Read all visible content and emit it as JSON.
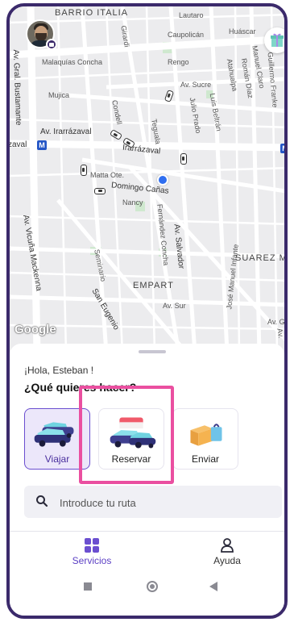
{
  "map": {
    "labels": {
      "barrio": "BARRIO ITALIA",
      "lautaro": "Lautaro",
      "caupolican": "Caupolicán",
      "huascar": "Huáscar",
      "grl_bustamante": "Av. Gral. Bustamante",
      "malaquias": "Malaquías Concha",
      "girardi": "Girardi",
      "rengo": "Rengo",
      "manuel_claro": "Manuel Claro",
      "roman_diaz": "Román Díaz",
      "atahualpa": "Atahualpa",
      "guillermo_franke": "Guillermo Franke",
      "mujica": "Mujica",
      "av_sucre": "Av. Sucre",
      "luis_beltran": "Luis Beltrán",
      "julio_prado": "Julio Prado",
      "condell": "Condell",
      "irarrazaval": "Av. Irarrázaval",
      "zaval": "zaval",
      "irarrazaval_mid": "Irarrázaval",
      "teguala": "Teguala",
      "matta_ote": "Matta Ote.",
      "domingo_canas": "Domingo Cañas",
      "nancy": "Nancy",
      "fernandez_concha": "Fernández Concha",
      "av_salvador": "Av. Salvador",
      "jose_manuel_infante": "José Manuel Infante",
      "suarez": "SUAREZ MUJ",
      "vicuna": "Av. Vicuña Mackenna",
      "seminario": "Seminario",
      "empart": "EMPART",
      "av_sur": "Av. Sur",
      "san_eugenio": "San Eugenio",
      "av_gre": "Av. Gre",
      "av": "Av.",
      "metro": "M",
      "google": "Google"
    }
  },
  "sheet": {
    "greeting": "¡Hola, Esteban !",
    "question": "¿Qué quieres hacer?",
    "options": [
      {
        "label": "Viajar",
        "active": true
      },
      {
        "label": "Reservar",
        "active": false
      },
      {
        "label": "Enviar",
        "active": false
      }
    ],
    "search_placeholder": "Introduce tu ruta"
  },
  "bottom_nav": {
    "services": "Servicios",
    "help": "Ayuda"
  },
  "colors": {
    "brand": "#3b2a6b",
    "accent": "#6b4fd0",
    "highlight": "#ea4fa0",
    "metro": "#2456c6"
  }
}
